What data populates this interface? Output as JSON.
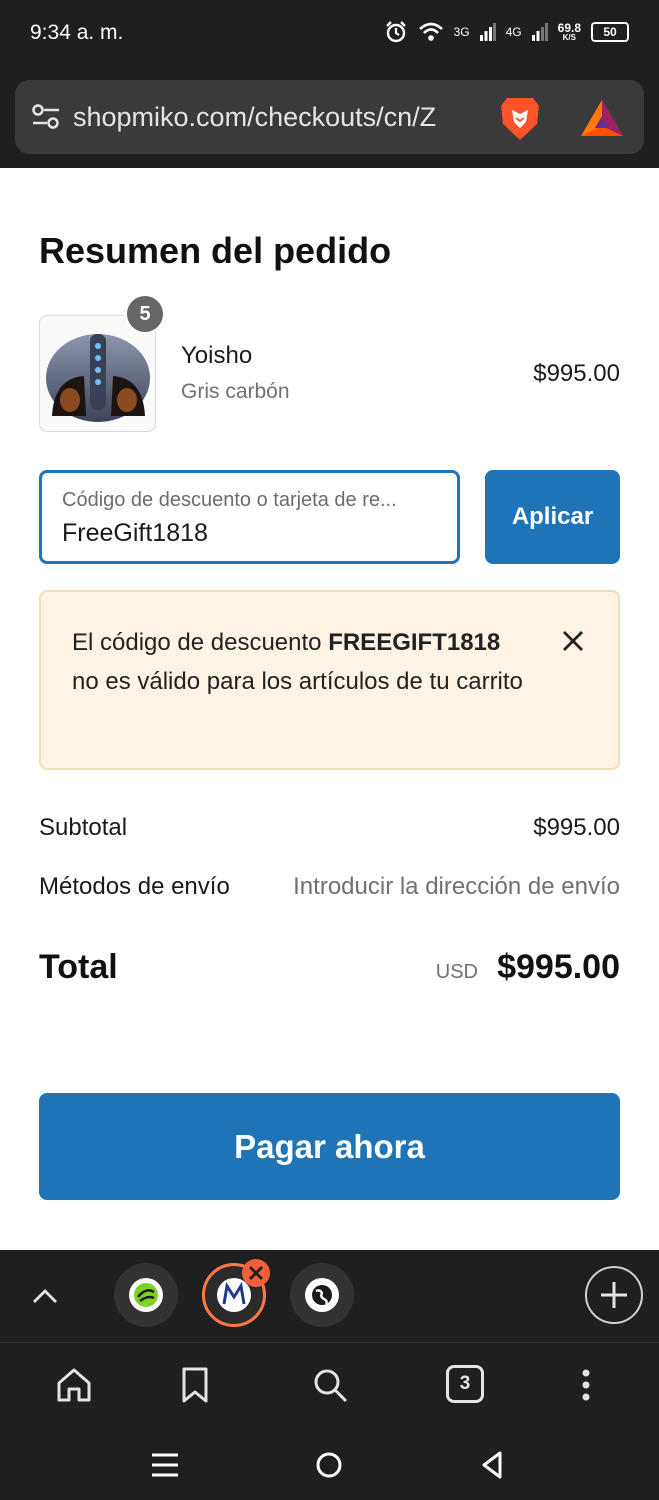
{
  "status_bar": {
    "time": "9:34 a. m.",
    "net_3g": "3G",
    "net_4g": "4G",
    "speed": "69.8",
    "speed_unit": "K/S",
    "battery": "50"
  },
  "browser": {
    "url": "shopmiko.com/checkouts/cn/Z",
    "tab_count": "3"
  },
  "order": {
    "title": "Resumen del pedido",
    "product": {
      "quantity": "5",
      "name": "Yoisho",
      "variant": "Gris carbón",
      "price": "$995.00"
    },
    "discount": {
      "placeholder": "Código de descuento o tarjeta de re...",
      "value": "FreeGift1818",
      "apply_label": "Aplicar"
    },
    "alert": {
      "prefix": "El código de descuento",
      "code": "FREEGIFT1818",
      "suffix": "no es válido para los artículos de tu carrito"
    },
    "subtotal_label": "Subtotal",
    "subtotal_value": "$995.00",
    "shipping_label": "Métodos de envío",
    "shipping_value": "Introducir la dirección de envío",
    "total_label": "Total",
    "total_currency": "USD",
    "total_value": "$995.00",
    "pay_label": "Pagar ahora"
  },
  "colors": {
    "accent": "#1f73b7",
    "alert_bg": "#fff3e6",
    "chrome_bg": "#1f1f1f"
  },
  "icons": {
    "address_bar": [
      "tune-icon",
      "brave-lion-icon",
      "bat-triangle-icon"
    ],
    "tab_strip": [
      "chevron-up-icon",
      "green-site-icon",
      "miko-m-icon",
      "globe-icon",
      "plus-icon"
    ],
    "nav": [
      "home-icon",
      "bookmark-icon",
      "search-icon",
      "tabs-icon",
      "more-vert-icon"
    ],
    "system": [
      "recents-icon",
      "home-circle-icon",
      "back-triangle-icon"
    ]
  }
}
